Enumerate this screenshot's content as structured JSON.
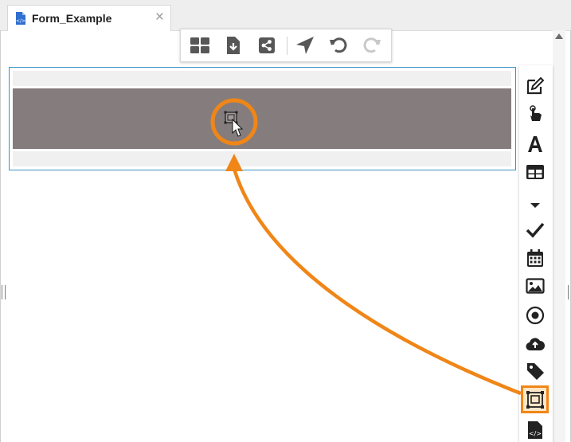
{
  "tab": {
    "title": "Form_Example",
    "close_symbol": "×"
  },
  "toolbar": {
    "buttons": [
      "layout-icon",
      "download-icon",
      "share-icon",
      "navigate-icon",
      "undo-icon",
      "redo-icon"
    ]
  },
  "palette": {
    "items": [
      "edit-icon",
      "pointer-icon",
      "text-icon",
      "table-icon",
      "dropdown-icon",
      "checkbox-icon",
      "calendar-icon",
      "image-icon",
      "radio-icon",
      "cloud-upload-icon",
      "tag-icon",
      "container-icon",
      "html-file-icon"
    ],
    "selected": "container-icon"
  },
  "colors": {
    "accent": "#f08617",
    "selection": "#3c92c6",
    "drop_zone": "#857d7d",
    "icon": "#3d3d3d"
  }
}
